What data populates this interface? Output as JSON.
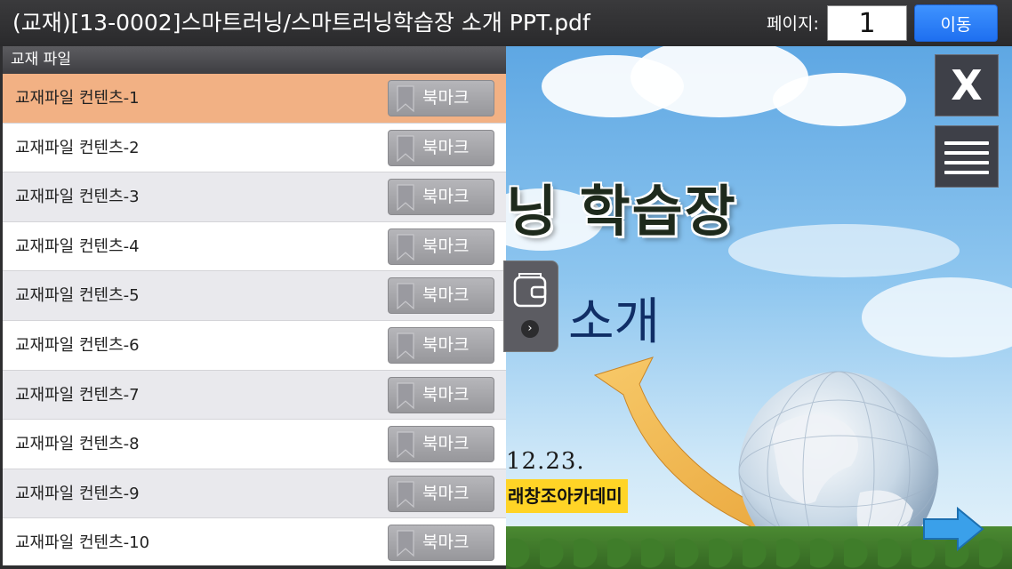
{
  "header": {
    "document_title": "(교재)[13-0002]스마트러닝/스마트러닝학습장 소개 PPT.pdf",
    "page_label": "페이지:",
    "page_value": "1",
    "go_label": "이동"
  },
  "panel": {
    "title": "교재 파일",
    "selected_index": 0,
    "items": [
      {
        "label": "교재파일 컨텐츠-1",
        "bookmark_label": "북마크"
      },
      {
        "label": "교재파일 컨텐츠-2",
        "bookmark_label": "북마크"
      },
      {
        "label": "교재파일 컨텐츠-3",
        "bookmark_label": "북마크"
      },
      {
        "label": "교재파일 컨텐츠-4",
        "bookmark_label": "북마크"
      },
      {
        "label": "교재파일 컨텐츠-5",
        "bookmark_label": "북마크"
      },
      {
        "label": "교재파일 컨텐츠-6",
        "bookmark_label": "북마크"
      },
      {
        "label": "교재파일 컨텐츠-7",
        "bookmark_label": "북마크"
      },
      {
        "label": "교재파일 컨텐츠-8",
        "bookmark_label": "북마크"
      },
      {
        "label": "교재파일 컨텐츠-9",
        "bookmark_label": "북마크"
      },
      {
        "label": "교재파일 컨텐츠-10",
        "bookmark_label": "북마크"
      }
    ]
  },
  "slide": {
    "title_fragment": "닝 학습장",
    "subtitle_fragment": "소개",
    "date_fragment": "12.23.",
    "org_fragment": "래창조아카데미"
  },
  "controls": {
    "close_label": "X",
    "close_icon": "close-icon",
    "menu_icon": "hamburger-menu-icon",
    "drawer_icon": "wallet-icon",
    "next_icon": "arrow-right-icon"
  },
  "colors": {
    "selected_row": "#f2b184",
    "go_button": "#2f83f8",
    "org_highlight": "#ffd426"
  }
}
